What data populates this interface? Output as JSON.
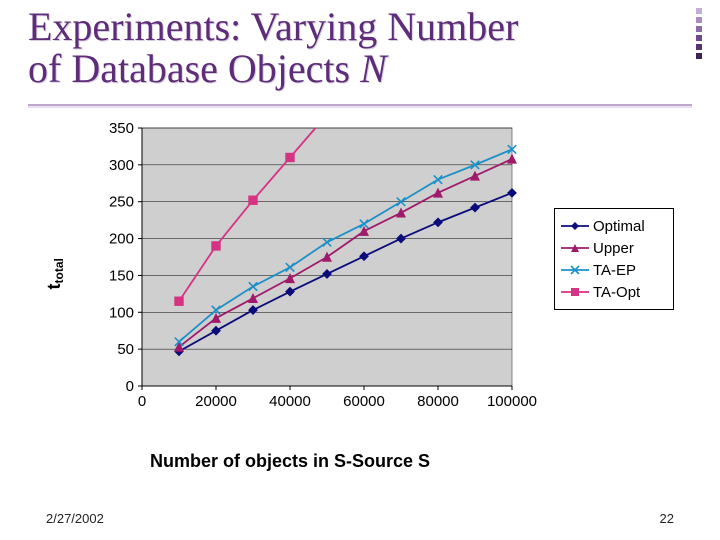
{
  "title_a": "Experiments: Varying Number",
  "title_b": "of Database Objects ",
  "title_ital": "N",
  "footer": {
    "date": "2/27/2002",
    "page": "22"
  },
  "ylabel_html": "t",
  "ylabel_sub": "total",
  "xlabel": "Number of objects in S-Source S",
  "legend": {
    "items": [
      {
        "name": "Optimal",
        "color": "#0b0b7a",
        "marker": "diamond"
      },
      {
        "name": "Upper",
        "color": "#a01a6b",
        "marker": "triangle"
      },
      {
        "name": "TA-EP",
        "color": "#1e90c8",
        "marker": "x"
      },
      {
        "name": "TA-Opt",
        "color": "#d63384",
        "marker": "square"
      }
    ]
  },
  "chart_data": {
    "type": "line",
    "x": [
      10000,
      20000,
      30000,
      40000,
      50000,
      60000,
      70000,
      80000,
      90000,
      100000
    ],
    "xlim": [
      0,
      100000
    ],
    "ylim": [
      0,
      350
    ],
    "xticks": [
      0,
      20000,
      40000,
      60000,
      80000,
      100000
    ],
    "yticks": [
      0,
      50,
      100,
      150,
      200,
      250,
      300,
      350
    ],
    "xlabel": "Number of objects in S-Source S",
    "ylabel": "t_total",
    "series": [
      {
        "name": "Optimal",
        "color": "#0b0b7a",
        "marker": "diamond",
        "values": [
          47,
          75,
          103,
          128,
          152,
          176,
          200,
          222,
          242,
          262
        ]
      },
      {
        "name": "Upper",
        "color": "#a01a6b",
        "marker": "triangle",
        "values": [
          53,
          92,
          119,
          146,
          175,
          210,
          235,
          262,
          285,
          308
        ]
      },
      {
        "name": "TA-EP",
        "color": "#1e90c8",
        "marker": "x",
        "values": [
          60,
          103,
          135,
          161,
          195,
          220,
          250,
          280,
          300,
          321
        ]
      },
      {
        "name": "TA-Opt",
        "color": "#d63384",
        "marker": "square",
        "values": [
          115,
          190,
          252,
          310,
          null,
          null,
          null,
          null,
          null,
          null
        ]
      }
    ]
  }
}
